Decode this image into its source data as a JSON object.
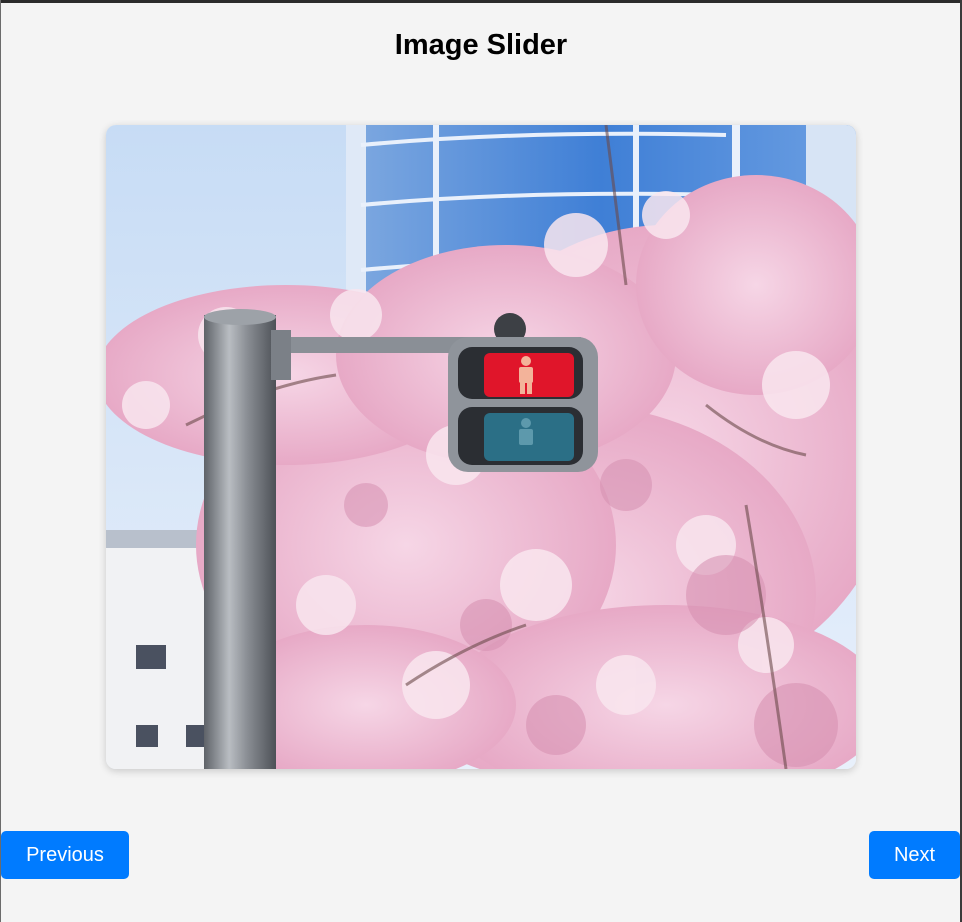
{
  "page": {
    "title": "Image Slider"
  },
  "slider": {
    "current_image": "cherry-blossoms-with-pedestrian-traffic-light"
  },
  "controls": {
    "previous_label": "Previous",
    "next_label": "Next"
  },
  "colors": {
    "background": "#f4f4f4",
    "button": "#007bff",
    "button_text": "#ffffff"
  }
}
